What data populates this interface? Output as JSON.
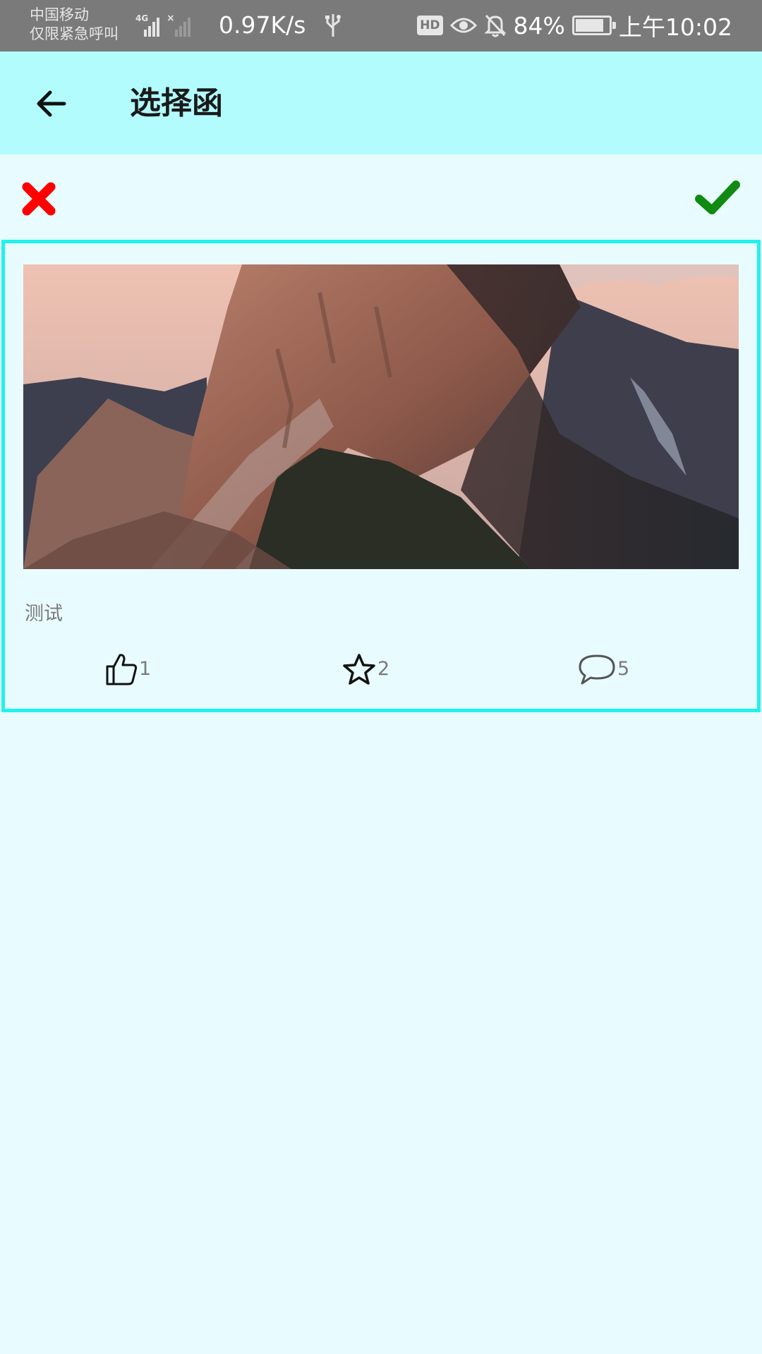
{
  "status_bar": {
    "carrier_line1": "中国移动",
    "carrier_line2": "仅限紧急呼叫",
    "network_type": "4G",
    "net_speed": "0.97K/s",
    "hd_badge": "HD",
    "battery_percent": "84%",
    "battery_level": 0.84,
    "time": "上午10:02",
    "icons": [
      "signal-icon",
      "usb-icon",
      "eye-icon",
      "bell-off-icon",
      "battery-icon"
    ]
  },
  "app_bar": {
    "title": "选择函",
    "back_icon": "arrow-left-icon",
    "background": "#b2fcfe"
  },
  "actions": {
    "cancel_icon": "close-icon",
    "cancel_color": "#ff0000",
    "confirm_icon": "check-icon",
    "confirm_color": "#108a10"
  },
  "post": {
    "image_icon": "mountain-photo",
    "text": "测试",
    "border_color": "#20f2ee",
    "likes": "1",
    "favorites": "2",
    "comments": "5",
    "like_icon": "thumbs-up-icon",
    "favorite_icon": "star-icon",
    "comment_icon": "comment-icon"
  }
}
